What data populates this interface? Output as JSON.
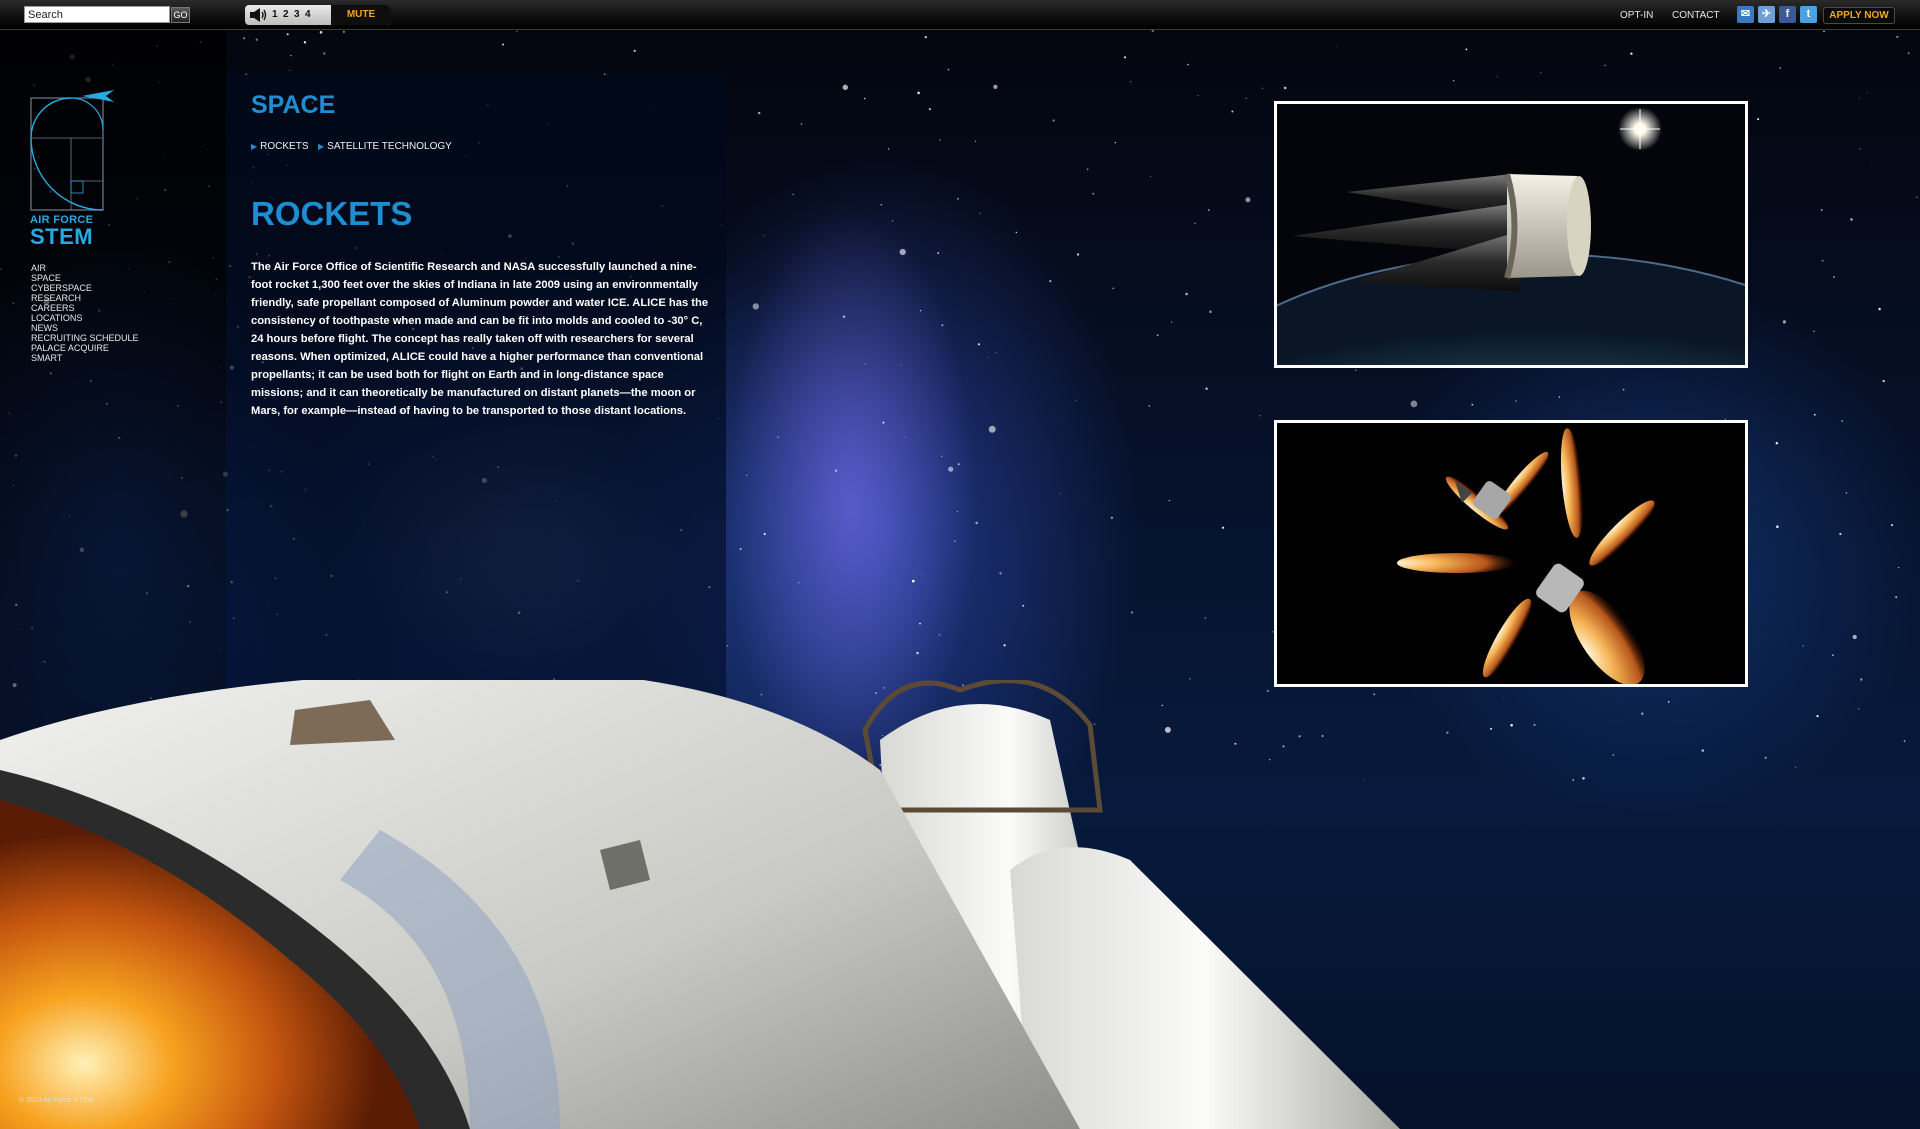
{
  "topbar": {
    "search_placeholder": "Search",
    "search_value": "Search",
    "go_label": "GO",
    "tracks": [
      "1",
      "2",
      "3",
      "4"
    ],
    "mute_label": "MUTE",
    "opt_in_label": "OPT-IN",
    "contact_label": "CONTACT",
    "apply_label": "APPLY NOW",
    "social_icons": [
      "email-icon",
      "air-force-icon",
      "facebook-icon",
      "twitter-icon"
    ]
  },
  "logo": {
    "line1": "AIR FORCE",
    "line2": "STEM"
  },
  "sidenav": {
    "items": [
      "AIR",
      "SPACE",
      "CYBERSPACE",
      "RESEARCH",
      "CAREERS",
      "LOCATIONS",
      "NEWS",
      "RECRUITING SCHEDULE",
      "PALACE ACQUIRE",
      "SMART"
    ]
  },
  "content": {
    "section_title": "SPACE",
    "subnav": [
      "ROCKETS",
      "SATELLITE TECHNOLOGY"
    ],
    "article_title": "ROCKETS",
    "article_body": "The Air Force Office of Scientific Research and NASA successfully launched a nine-foot rocket 1,300 feet over the skies of Indiana in late 2009 using an environmentally friendly, safe propellant composed of Aluminum powder and water ICE. ALICE has the consistency of toothpaste when made and can be fit into molds and cooled to -30° C, 24 hours before flight. The concept has really taken off with researchers for several reasons. When optimized, ALICE could have a higher performance than conventional propellants; it can be used both for flight on Earth and in long-distance space missions; and it can theoretically be manufactured on distant planets—the moon or Mars, for example—instead of having to be transported to those distant locations."
  },
  "footer": {
    "copyright": "© 2013 Air Force STEM"
  },
  "colors": {
    "accent_blue": "#1e8ed2",
    "logo_blue": "#29a9e1",
    "apply_orange": "#f2a81a"
  }
}
